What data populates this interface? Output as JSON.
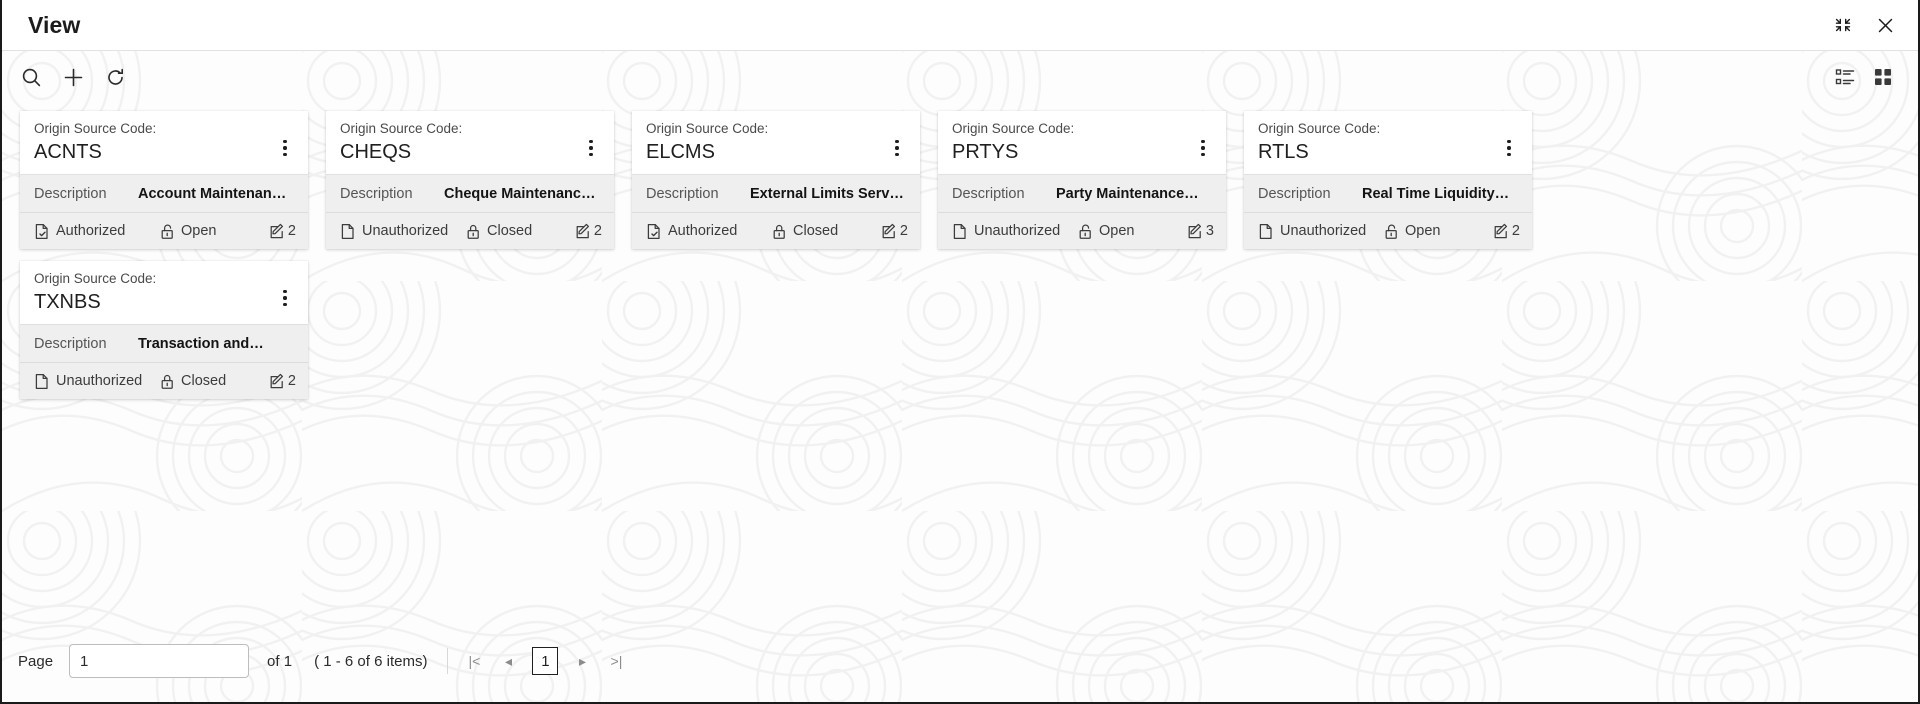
{
  "window": {
    "title": "View",
    "restore_icon": "restore-down-icon",
    "close_icon": "close-icon"
  },
  "toolbar": {
    "search_icon": "search-icon",
    "add_icon": "plus-icon",
    "refresh_icon": "refresh-icon",
    "list_view_icon": "list-view-icon",
    "tile_view_icon": "tile-view-icon"
  },
  "card_labels": {
    "origin_source_code": "Origin Source Code:",
    "description_key": "Description"
  },
  "cards": [
    {
      "code": "ACNTS",
      "description": "Account Maintenanc…",
      "authorization": "Authorized",
      "auth_icon": "document-check-icon",
      "lock_status": "Open",
      "lock_icon": "padlock-open-icon",
      "count": "2",
      "count_icon": "edit-square-icon",
      "kebab_icon": "kebab-menu-icon"
    },
    {
      "code": "CHEQS",
      "description": "Cheque Maintenance…",
      "authorization": "Unauthorized",
      "auth_icon": "document-icon",
      "lock_status": "Closed",
      "lock_icon": "padlock-closed-icon",
      "count": "2",
      "count_icon": "edit-square-icon",
      "kebab_icon": "kebab-menu-icon"
    },
    {
      "code": "ELCMS",
      "description": "External Limits Service",
      "authorization": "Authorized",
      "auth_icon": "document-check-icon",
      "lock_status": "Closed",
      "lock_icon": "padlock-closed-icon",
      "count": "2",
      "count_icon": "edit-square-icon",
      "kebab_icon": "kebab-menu-icon"
    },
    {
      "code": "PRTYS",
      "description": "Party Maintenance…",
      "authorization": "Unauthorized",
      "auth_icon": "document-icon",
      "lock_status": "Open",
      "lock_icon": "padlock-open-icon",
      "count": "3",
      "count_icon": "edit-square-icon",
      "kebab_icon": "kebab-menu-icon"
    },
    {
      "code": "RTLS",
      "description": "Real Time Liquidity…",
      "authorization": "Unauthorized",
      "auth_icon": "document-icon",
      "lock_status": "Open",
      "lock_icon": "padlock-open-icon",
      "count": "2",
      "count_icon": "edit-square-icon",
      "kebab_icon": "kebab-menu-icon"
    },
    {
      "code": "TXNBS",
      "description": "Transaction and…",
      "authorization": "Unauthorized",
      "auth_icon": "document-icon",
      "lock_status": "Closed",
      "lock_icon": "padlock-closed-icon",
      "count": "2",
      "count_icon": "edit-square-icon",
      "kebab_icon": "kebab-menu-icon"
    }
  ],
  "pagination": {
    "page_label": "Page",
    "page_value": "1",
    "of_text": "of 1",
    "items_text": "( 1 - 6 of 6 items)",
    "first_icon": "|<",
    "prev_icon": "◂",
    "current_page": "1",
    "next_icon": "▸",
    "last_icon": ">|"
  },
  "colors": {
    "card_bg": "#ffffff",
    "card_alt_bg": "#efefef",
    "text_primary": "#1f1f1f",
    "text_secondary": "#555555",
    "border": "#1a1a1a"
  }
}
